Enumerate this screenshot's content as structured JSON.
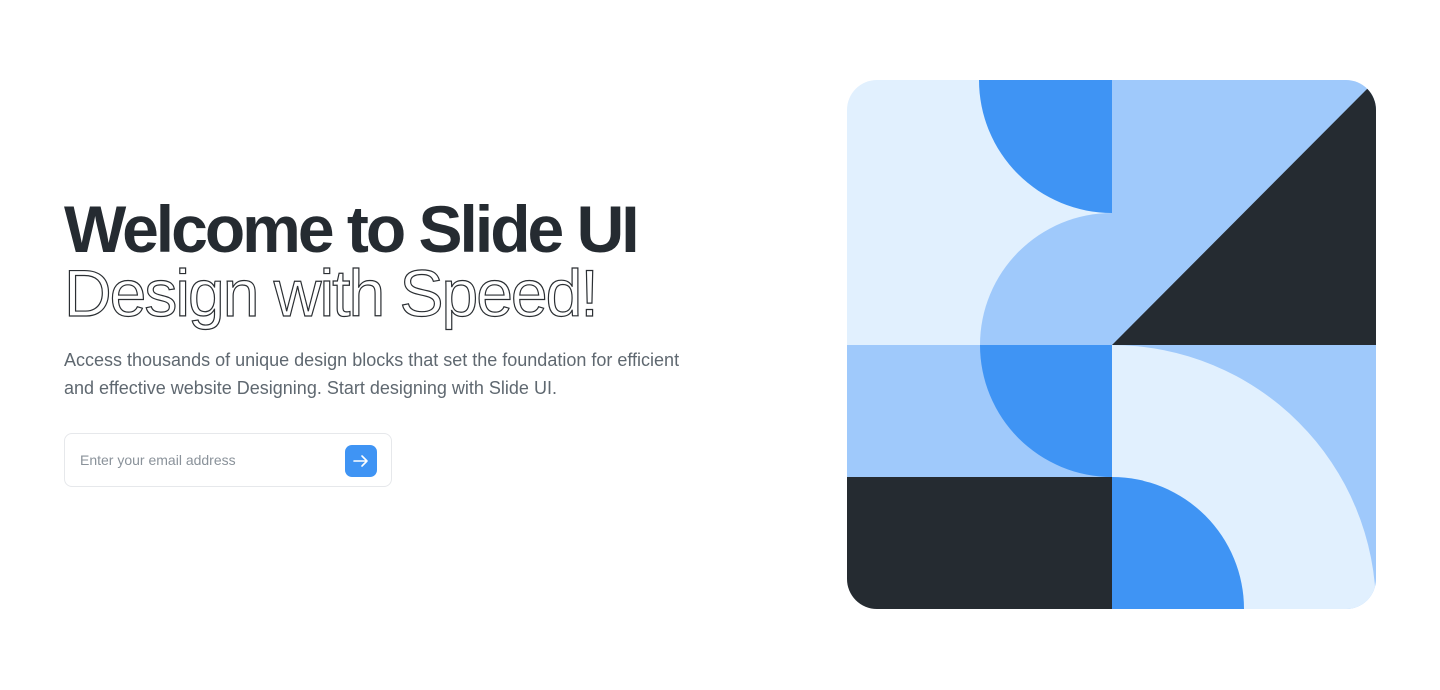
{
  "hero": {
    "title": "Welcome to Slide UI",
    "subtitle": "Design with Speed!",
    "description": "Access thousands of unique design blocks that set the foundation for efficient and effective website Designing. Start designing with Slide UI."
  },
  "signup": {
    "email_placeholder": "Enter your email address",
    "submit_icon": "arrow-right-icon"
  },
  "colors": {
    "heading": "#252b31",
    "body_text": "#5f6870",
    "accent_blue": "#3f94f4",
    "light_blue": "#9fc9fb",
    "pale_blue": "#e1f0fe",
    "dark": "#252b31"
  }
}
